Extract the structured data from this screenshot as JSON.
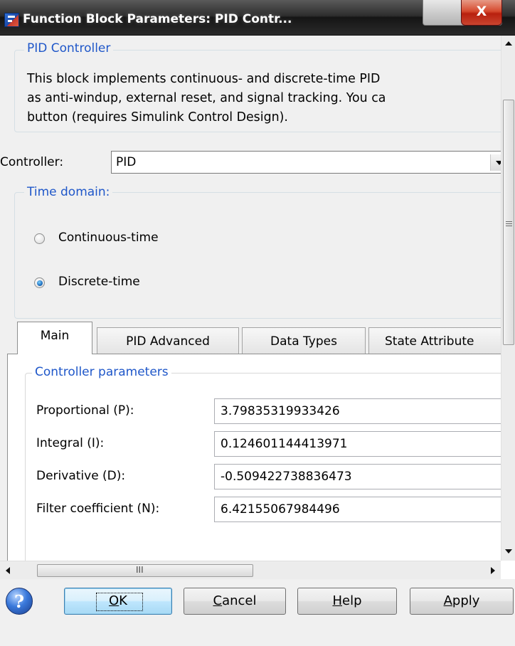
{
  "window": {
    "title": "Function Block Parameters: PID Contr...",
    "close_glyph": "X",
    "icon": "simulink-block-icon"
  },
  "block": {
    "name": "PID Controller",
    "description_lines": [
      "This block implements continuous- and discrete-time PID",
      "as anti-windup, external reset, and signal tracking. You ca",
      "button (requires Simulink Control Design)."
    ]
  },
  "controller": {
    "label": "Controller:",
    "value": "PID"
  },
  "time_domain": {
    "legend": "Time domain:",
    "options": [
      {
        "label": "Continuous-time",
        "selected": false
      },
      {
        "label": "Discrete-time",
        "selected": true
      }
    ]
  },
  "tabs": [
    {
      "label": "Main",
      "active": true
    },
    {
      "label": "PID Advanced",
      "active": false
    },
    {
      "label": "Data Types",
      "active": false
    },
    {
      "label": "State Attribute",
      "active": false
    }
  ],
  "parameters": {
    "legend": "Controller parameters",
    "fields": [
      {
        "label": "Proportional (P):",
        "value": "3.79835319933426"
      },
      {
        "label": "Integral (I):",
        "value": "0.124601144413971"
      },
      {
        "label": "Derivative (D):",
        "value": "-0.509422738836473"
      },
      {
        "label": "Filter coefficient (N):",
        "value": "6.42155067984496"
      }
    ]
  },
  "hscroll_grip": "III",
  "buttons": {
    "help_icon_glyph": "?",
    "ok": {
      "mnemonic": "O",
      "rest": "K"
    },
    "cancel": {
      "mnemonic": "C",
      "rest": "ancel"
    },
    "help": {
      "mnemonic": "H",
      "rest": "elp"
    },
    "apply": {
      "mnemonic": "A",
      "rest": "pply"
    }
  },
  "colors": {
    "accent_legend": "#1f57c9",
    "titlebar": "#2e2e2e",
    "close_button": "#c9452f",
    "default_button": "#bee6fd"
  }
}
